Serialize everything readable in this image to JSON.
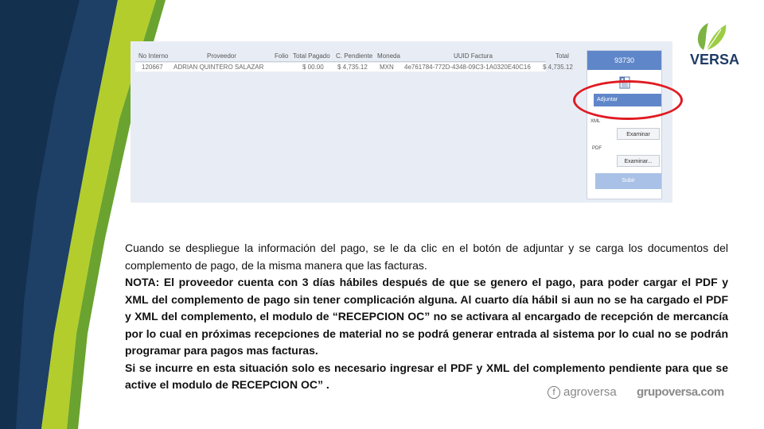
{
  "colors": {
    "navy": "#1e3f66",
    "dark_navy": "#14304f",
    "lime": "#b3cd2c",
    "green": "#6aa32f",
    "button_blue": "#5f86c9",
    "highlight_red": "#e01b22"
  },
  "screenshot": {
    "columns": [
      "No Interno",
      "Proveedor",
      "Folio",
      "Total Pagado",
      "C. Pendiente",
      "Moneda",
      "UUID Factura",
      "Total"
    ],
    "row": [
      "120667",
      "ADRIAN QUINTERO SALAZAR",
      "",
      "$ 00.00",
      "$ 4,735.12",
      "MXN",
      "4e761784-772D-4348-09C3-1A0320E40C16",
      "$ 4,735.12"
    ],
    "panel": {
      "order_number": "93730",
      "excel_icon": "excel-icon",
      "attach_label": "Adjuntar",
      "xml_label": "XML",
      "xml_browse": "Examinar",
      "pdf_label": "PDF",
      "pdf_browse": "Examinar...",
      "upload_label": "Subir"
    }
  },
  "logo": {
    "brand": "VERSA"
  },
  "text": {
    "p1": "Cuando se despliegue la información del pago, se le da clic en el botón de adjuntar y se carga los documentos del complemento de pago, de la misma manera que las facturas.",
    "p2": "NOTA: El proveedor cuenta con 3 días hábiles después de que se genero el pago, para poder cargar el PDF y XML del complemento de pago sin tener complicación alguna. Al cuarto día hábil si aun no se ha cargado el PDF y XML del complemento, el modulo de “RECEPCION OC” no se activara al encargado de recepción de mercancía por lo cual  en próximas recepciones de material no se podrá generar entrada al sistema por lo cual no se podrán programar para pagos mas facturas.",
    "p3": "Si se incurre en esta situación solo es necesario ingresar el PDF y XML del complemento pendiente para que se active el modulo de RECEPCION OC” ."
  },
  "footer": {
    "facebook_icon": "facebook-icon",
    "agroversa": "agroversa",
    "grupoversa": "grupoversa.com"
  }
}
